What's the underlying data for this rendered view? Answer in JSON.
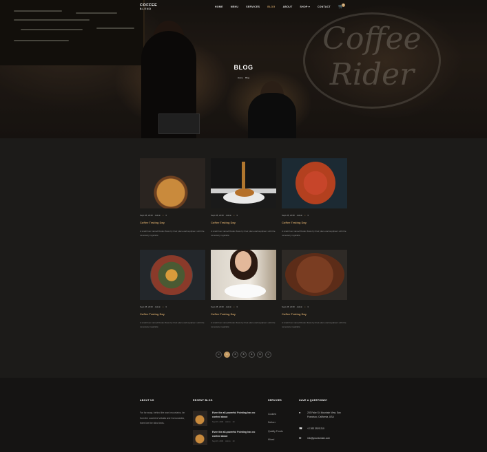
{
  "brand": {
    "name": "COFFEE",
    "tagline": "BLEND"
  },
  "nav": {
    "items": [
      "HOME",
      "MENU",
      "SERVICES",
      "BLOG",
      "ABOUT",
      "SHOP",
      "CONTACT"
    ],
    "active": "BLOG",
    "cart_count": "0"
  },
  "hero": {
    "title": "BLOG",
    "crumb_home": "Home",
    "crumb_sep": "",
    "crumb_current": "Blog"
  },
  "posts": [
    {
      "date": "Sept 28, 2018",
      "author": "Admin",
      "comments": "3",
      "title": "Coffee Testing Day",
      "excerpt": "A small river named Duden flows by their place and supplies it with the necessary regelialia"
    },
    {
      "date": "Sept 28, 2018",
      "author": "Admin",
      "comments": "3",
      "title": "Coffee Testing Day",
      "excerpt": "A small river named Duden flows by their place and supplies it with the necessary regelialia"
    },
    {
      "date": "Sept 28, 2018",
      "author": "Admin",
      "comments": "3",
      "title": "Coffee Testing Day",
      "excerpt": "A small river named Duden flows by their place and supplies it with the necessary regelialia"
    },
    {
      "date": "Sept 28, 2018",
      "author": "Admin",
      "comments": "3",
      "title": "Coffee Testing Day",
      "excerpt": "A small river named Duden flows by their place and supplies it with the necessary regelialia"
    },
    {
      "date": "Sept 28, 2018",
      "author": "Admin",
      "comments": "3",
      "title": "Coffee Testing Day",
      "excerpt": "A small river named Duden flows by their place and supplies it with the necessary regelialia"
    },
    {
      "date": "Sept 28, 2018",
      "author": "Admin",
      "comments": "3",
      "title": "Coffee Testing Day",
      "excerpt": "A small river named Duden flows by their place and supplies it with the necessary regelialia"
    }
  ],
  "pagination": {
    "prev": "<",
    "pages": [
      "1",
      "2",
      "3",
      "4",
      "5"
    ],
    "next": ">",
    "active": "1"
  },
  "footer": {
    "about_title": "ABOUT US",
    "about_text": "Far far away, behind the word mountains, far from the countries Vokalia and Consonantia, there live the blind texts.",
    "recent_title": "RECENT BLOG",
    "recent": [
      {
        "title": "Even the all-powerful Pointing has no control about",
        "date": "Sept 15, 2018",
        "author": "Admin",
        "comments": "19"
      },
      {
        "title": "Even the all-powerful Pointing has no control about",
        "date": "Sept 15, 2018",
        "author": "Admin",
        "comments": "19"
      }
    ],
    "services_title": "SERVICES",
    "services": [
      "Cooked",
      "Deliver",
      "Quality Foods",
      "Mixed"
    ],
    "contact_title": "HAVE A QUESTIONS?",
    "address": "203 Fake St. Mountain View, San Francisco, California, USA",
    "phone": "+2 392 3929 210",
    "email": "info@yourdomain.com"
  },
  "icons": {
    "cart": "cart-icon",
    "comment": "comment-icon",
    "map": "map-marker-icon",
    "phone": "phone-icon",
    "email": "email-icon"
  },
  "colors": {
    "accent": "#c49b63",
    "background": "#1c1b19",
    "footer": "#151413"
  }
}
